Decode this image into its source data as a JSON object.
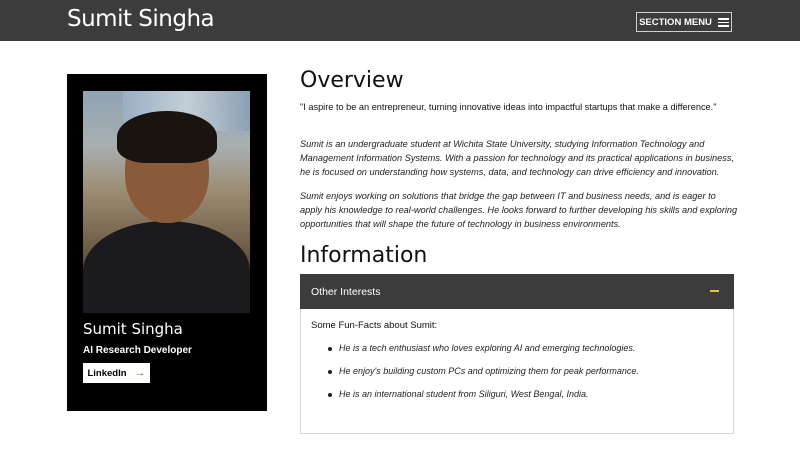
{
  "header": {
    "site_title": "Sumit Singha",
    "section_menu_label": "SECTION MENU"
  },
  "profile": {
    "name": "Sumit Singha",
    "role": "AI Research Developer",
    "linkedin_label": "LinkedIn",
    "linkedin_arrow": "→"
  },
  "overview": {
    "heading": "Overview",
    "quote": "\"I aspire to be an entrepreneur, turning innovative ideas into impactful startups that make a difference.\"",
    "paragraphs": [
      "Sumit is an undergraduate student at Wichita State University, studying Information Technology and Management Information Systems. With a passion for technology and its practical applications in business, he is focused on understanding how systems, data, and technology can drive efficiency and innovation.",
      "Sumit enjoys working on solutions that bridge the gap between IT and business needs, and is eager to apply his knowledge to real-world challenges. He looks forward to further developing his skills and exploring opportunities that will shape the future of technology in business environments."
    ]
  },
  "information": {
    "heading": "Information",
    "accordion": {
      "title": "Other Interests",
      "intro": "Some Fun-Facts about Sumit:",
      "items": [
        "He is a tech enthusiast who loves exploring AI and emerging technologies.",
        "He enjoy's building custom PCs and optimizing them for peak performance.",
        "He is an international student from Siliguri, West Bengal, India."
      ]
    }
  },
  "colors": {
    "header_bg": "#3c3c3c",
    "card_bg": "#000000",
    "accent_minus": "#f0c030",
    "arrow": "#c24d2c"
  }
}
